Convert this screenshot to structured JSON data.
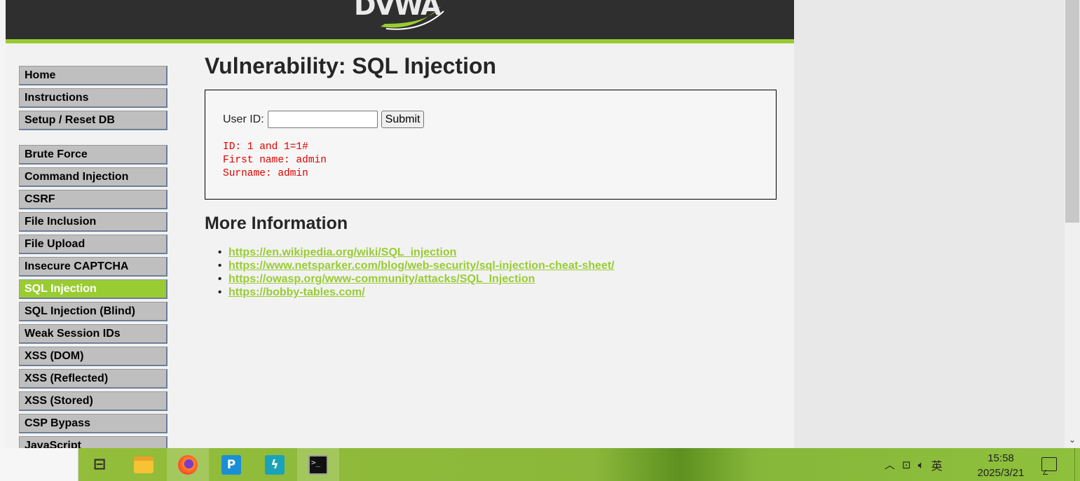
{
  "header": {
    "logo_text": "DVWA"
  },
  "menu": {
    "group1": [
      {
        "label": "Home"
      },
      {
        "label": "Instructions"
      },
      {
        "label": "Setup / Reset DB"
      }
    ],
    "group2": [
      {
        "label": "Brute Force"
      },
      {
        "label": "Command Injection"
      },
      {
        "label": "CSRF"
      },
      {
        "label": "File Inclusion"
      },
      {
        "label": "File Upload"
      },
      {
        "label": "Insecure CAPTCHA"
      },
      {
        "label": "SQL Injection",
        "active": true
      },
      {
        "label": "SQL Injection (Blind)"
      },
      {
        "label": "Weak Session IDs"
      },
      {
        "label": "XSS (DOM)"
      },
      {
        "label": "XSS (Reflected)"
      },
      {
        "label": "XSS (Stored)"
      },
      {
        "label": "CSP Bypass"
      },
      {
        "label": "JavaScript"
      }
    ]
  },
  "main": {
    "title": "Vulnerability: SQL Injection",
    "form": {
      "label": "User ID:",
      "input_value": "",
      "submit_label": "Submit"
    },
    "result_lines": [
      "ID: 1 and 1=1#",
      "First name: admin",
      "Surname: admin"
    ],
    "more_info_title": "More Information",
    "links": [
      "https://en.wikipedia.org/wiki/SQL_injection",
      "https://www.netsparker.com/blog/web-security/sql-injection-cheat-sheet/",
      "https://owasp.org/www-community/attacks/SQL_Injection",
      "https://bobby-tables.com/"
    ]
  },
  "taskbar": {
    "apps": [
      "task-view-icon",
      "file-explorer-icon",
      "firefox-icon",
      "p-app-icon",
      "bolt-app-icon",
      "terminal-icon"
    ],
    "tray": {
      "ime": "英"
    },
    "clock": {
      "time": "15:58",
      "date": "2025/3/21"
    }
  },
  "colors": {
    "accent": "#99cc33",
    "header_bg": "#2f2f2f",
    "result_text": "#e00000"
  }
}
